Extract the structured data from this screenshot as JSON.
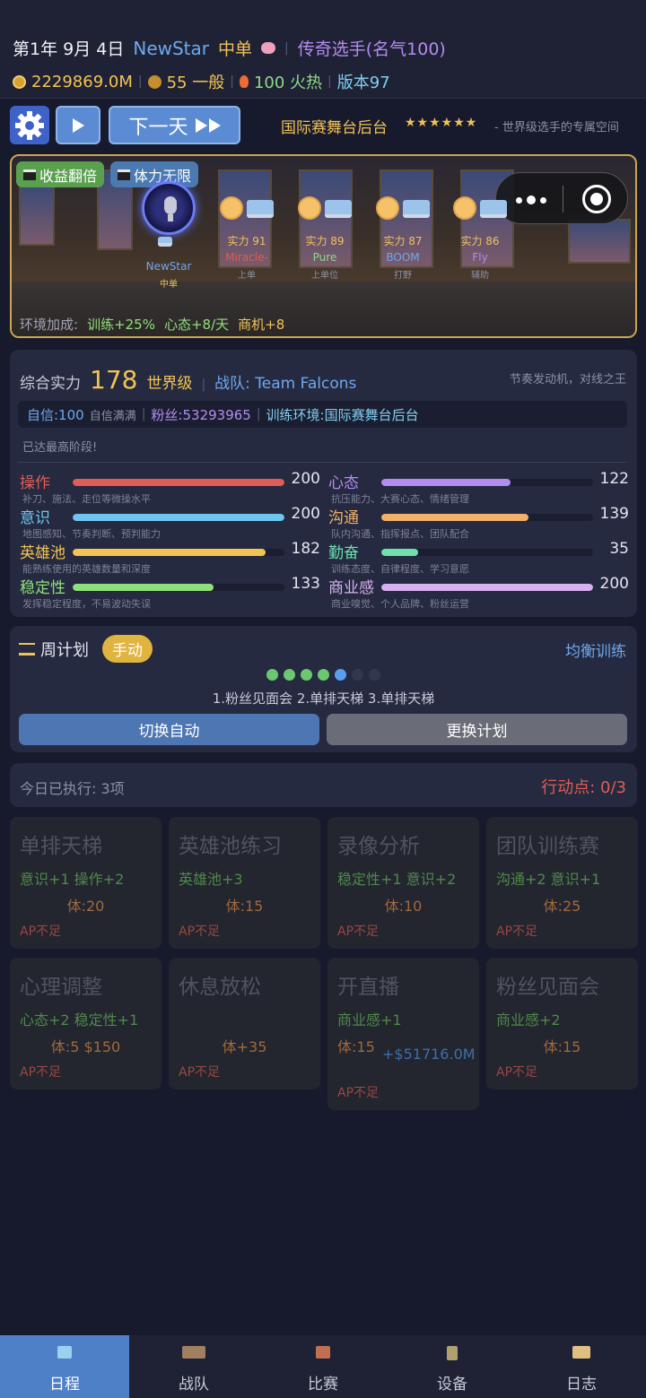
{
  "header": {
    "date": "第1年 9月 4日",
    "player_name": "NewStar",
    "role": "中单",
    "title": "传奇选手(名气100)",
    "money": "2229869.0M",
    "rating": "55 一般",
    "heat": "100 火热",
    "version": "版本97"
  },
  "toolbar": {
    "next_day_label": "下一天",
    "stage_name": "国际赛舞台后台",
    "stars": "★★★★★★",
    "stage_desc": "- 世界级选手的专属空间"
  },
  "scene": {
    "tags": [
      "收益翻倍",
      "体力无限"
    ],
    "me": {
      "name": "NewStar",
      "role": "中单"
    },
    "teammates": [
      {
        "strength": "实力 91",
        "name": "Miracle-",
        "role": "上单",
        "color": "#e05d55"
      },
      {
        "strength": "实力 89",
        "name": "Pure",
        "role": "上单位",
        "color": "#8fd88a"
      },
      {
        "strength": "实力 87",
        "name": "BOOM",
        "role": "打野",
        "color": "#6ea8f0"
      },
      {
        "strength": "实力 86",
        "name": "Fly",
        "role": "辅助",
        "color": "#b48cf0"
      }
    ],
    "env_label": "环境加成:",
    "env_items": [
      "训练+25%",
      "心态+8/天",
      "商机+8"
    ]
  },
  "stats": {
    "overall_label": "综合实力",
    "overall_value": "178",
    "level": "世界级",
    "team": "战队: Team Falcons",
    "motto": "节奏发动机，对线之王",
    "confidence": "自信:100",
    "confidence_note": "自信满满",
    "fans": "粉丝:53293965",
    "environment": "训练环境:国际赛舞台后台",
    "max_stage": "已达最高阶段!",
    "attrs": [
      {
        "name": "操作",
        "value": "200",
        "max": 200,
        "desc": "补刀、施法、走位等微操水平",
        "color": "#e05d55"
      },
      {
        "name": "心态",
        "value": "122",
        "max": 200,
        "desc": "抗压能力、大赛心态、情绪管理",
        "color": "#b48cf0"
      },
      {
        "name": "意识",
        "value": "200",
        "max": 200,
        "desc": "地图感知、节奏判断、预判能力",
        "color": "#6ec6f0"
      },
      {
        "name": "沟通",
        "value": "139",
        "max": 200,
        "desc": "队内沟通、指挥报点、团队配合",
        "color": "#f2b06a"
      },
      {
        "name": "英雄池",
        "value": "182",
        "max": 200,
        "desc": "能熟练使用的英雄数量和深度",
        "color": "#f2c452"
      },
      {
        "name": "勤奋",
        "value": "35",
        "max": 200,
        "desc": "训练态度、自律程度、学习意愿",
        "color": "#6ee0b0"
      },
      {
        "name": "稳定性",
        "value": "133",
        "max": 200,
        "desc": "发挥稳定程度，不易波动失误",
        "color": "#8fe07a"
      },
      {
        "name": "商业感",
        "value": "200",
        "max": 200,
        "desc": "商业嗅觉、个人品牌、粉丝运营",
        "color": "#d6b0f0"
      }
    ]
  },
  "plan": {
    "title": "周计划",
    "mode": "手动",
    "type": "均衡训练",
    "progress_done": 4,
    "progress_current": 5,
    "progress_total": 7,
    "items": "1.粉丝见面会  2.单排天梯  3.单排天梯",
    "auto_label": "切换自动",
    "change_label": "更换计划"
  },
  "today": {
    "executed": "今日已执行: 3项",
    "ap": "行动点: 0/3"
  },
  "actions": [
    {
      "title": "单排天梯",
      "effect": "意识+1 操作+2",
      "cost": "体:20",
      "ap": "AP不足"
    },
    {
      "title": "英雄池练习",
      "effect": "英雄池+3",
      "cost": "体:15",
      "ap": "AP不足"
    },
    {
      "title": "录像分析",
      "effect": "稳定性+1 意识+2",
      "cost": "体:10",
      "ap": "AP不足"
    },
    {
      "title": "团队训练赛",
      "effect": "沟通+2 意识+1",
      "cost": "体:25",
      "ap": "AP不足"
    },
    {
      "title": "心理调整",
      "effect": "心态+2 稳定性+1",
      "cost": "体:5 $150",
      "ap": "AP不足"
    },
    {
      "title": "休息放松",
      "effect": "",
      "cost": "体+35",
      "ap": "AP不足"
    },
    {
      "title": "开直播",
      "effect": "商业感+1",
      "cost": "体:15",
      "gain": "+$51716.0M",
      "ap": "AP不足"
    },
    {
      "title": "粉丝见面会",
      "effect": "商业感+2",
      "cost": "体:15",
      "ap": "AP不足"
    }
  ],
  "nav": [
    {
      "label": "日程",
      "icon": "calendar-icon",
      "active": true
    },
    {
      "label": "战队",
      "icon": "team-icon",
      "active": false
    },
    {
      "label": "比赛",
      "icon": "match-icon",
      "active": false
    },
    {
      "label": "设备",
      "icon": "device-icon",
      "active": false
    },
    {
      "label": "日志",
      "icon": "log-icon",
      "active": false
    }
  ]
}
